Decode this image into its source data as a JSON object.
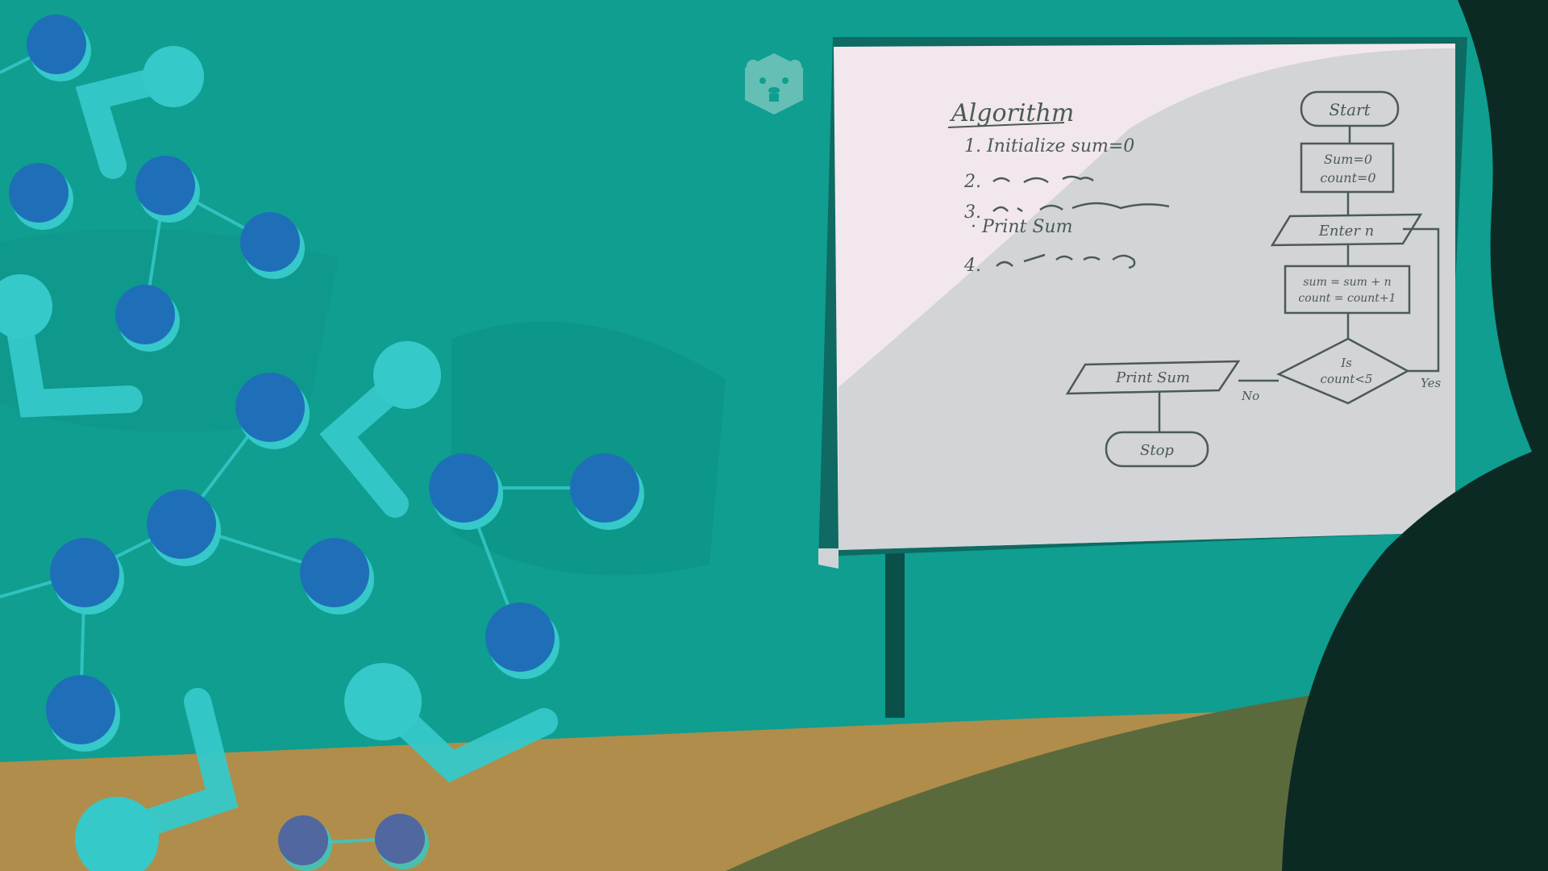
{
  "colors": {
    "wall": "#0f9e90",
    "wall_shade": "#0c8a7e",
    "desk": "#b08d4a",
    "desk_shadow": "#5b6a3c",
    "whiteboard": "#f1e7ec",
    "whiteboard_frame": "#0e6a62",
    "board_ink": "#4b5a55",
    "molecule_light": "#35c9c9",
    "molecule_dark": "#1f6fb8",
    "silhouette": "#0c2a24"
  },
  "logo": {
    "icon": "beaver-logo-icon"
  },
  "whiteboard": {
    "algorithm": {
      "heading": "Algorithm",
      "steps": [
        "1. Initialize sum=0",
        "2.",
        "3.",
        "· Print Sum",
        "4."
      ]
    },
    "flowchart": {
      "start": "Start",
      "init_line1": "Sum=0",
      "init_line2": "count=0",
      "input": "Enter n",
      "process_line1": "sum = sum + n",
      "process_line2": "count = count+1",
      "decision_line1": "Is",
      "decision_line2": "count<5",
      "yes_label": "Yes",
      "no_label": "No",
      "output": "Print Sum",
      "stop": "Stop"
    }
  }
}
